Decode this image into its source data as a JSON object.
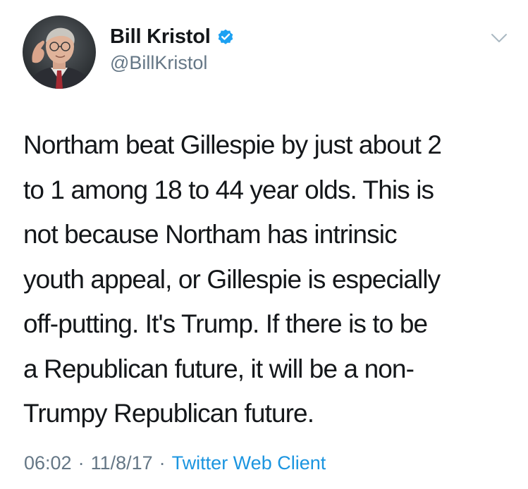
{
  "tweet": {
    "author": {
      "display_name": "Bill Kristol",
      "handle": "@BillKristol",
      "verified": true
    },
    "text": "Northam beat Gillespie by just about 2\nto 1 among 18 to 44 year olds. This is\nnot because Northam has intrinsic\nyouth appeal, or Gillespie is especially\noff-putting. It's Trump. If there is to be\na Republican future, it will be a non-\nTrumpy Republican future.",
    "time": "06:02",
    "date": "11/8/17",
    "separator": "·",
    "client": "Twitter Web Client"
  },
  "colors": {
    "text": "#14171a",
    "secondary": "#657786",
    "accent": "#1b95e0",
    "verified_badge": "#1da1f2"
  },
  "icons": {
    "verified": "verified-badge-icon",
    "caret": "chevron-down-icon"
  }
}
